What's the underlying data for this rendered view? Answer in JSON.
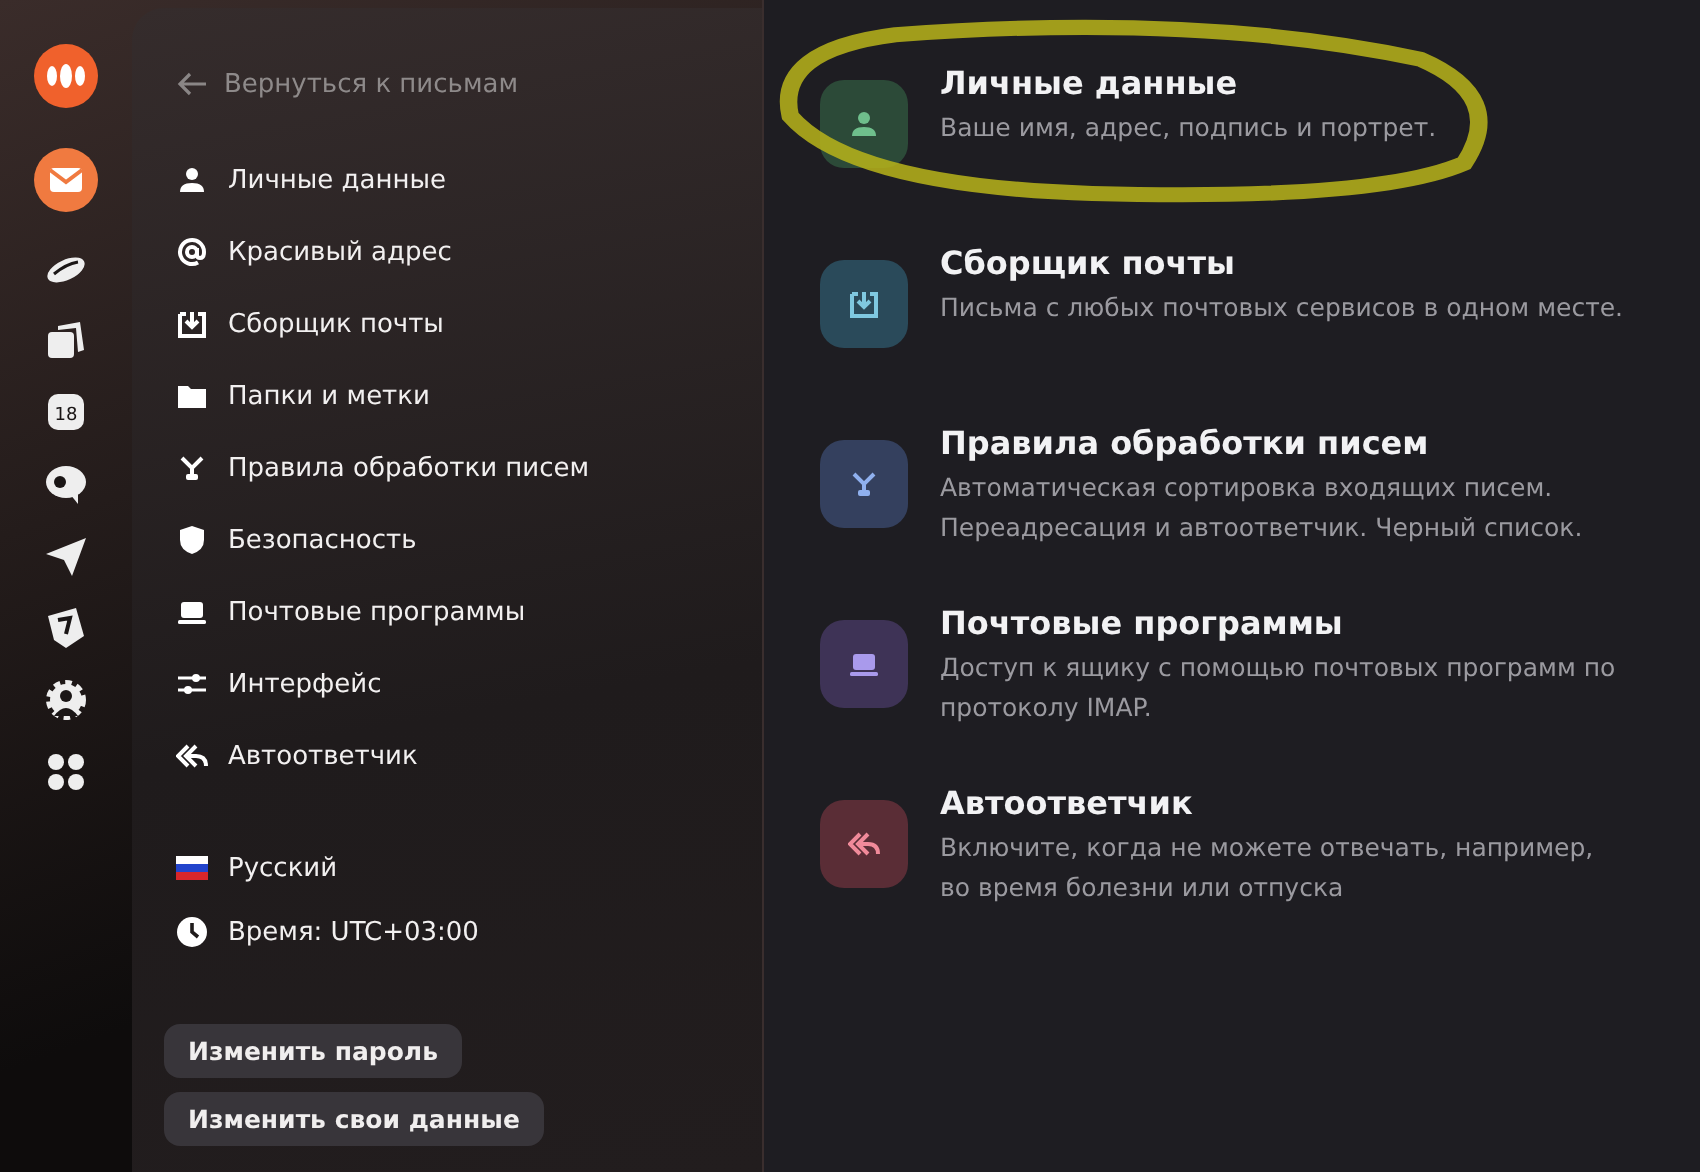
{
  "calendar_day": "18",
  "back_link": "Вернуться к письмам",
  "nav": [
    {
      "label": "Личные данные"
    },
    {
      "label": "Красивый адрес"
    },
    {
      "label": "Сборщик почты"
    },
    {
      "label": "Папки и метки"
    },
    {
      "label": "Правила обработки писем"
    },
    {
      "label": "Безопасность"
    },
    {
      "label": "Почтовые программы"
    },
    {
      "label": "Интерфейс"
    },
    {
      "label": "Автоответчик"
    }
  ],
  "language": "Русский",
  "time": "Время: UTC+03:00",
  "buttons": [
    "Изменить пароль",
    "Изменить свои данные"
  ],
  "cards": [
    {
      "title": "Личные данные",
      "description": "Ваше имя, адрес, подпись и портрет.",
      "color": "#2c4a38",
      "highlighted": true
    },
    {
      "title": "Сборщик почты",
      "description": "Письма с любых почтовых сервисов в одном месте.",
      "color": "#2a4a5a",
      "highlighted": false
    },
    {
      "title": "Правила обработки писем",
      "description": "Автоматическая сортировка входящих писем. Переадресация и автоответчик. Черный список.",
      "color": "#34405e",
      "highlighted": false
    },
    {
      "title": "Почтовые программы",
      "description": "Доступ к ящику с помощью почтовых программ по протоколу IMAP.",
      "color": "#3e3356",
      "highlighted": false
    },
    {
      "title": "Автоответчик",
      "description": "Включите, когда не можете отвечать, например, во время болезни или отпуска",
      "color": "#5a2d36",
      "highlighted": false
    }
  ]
}
